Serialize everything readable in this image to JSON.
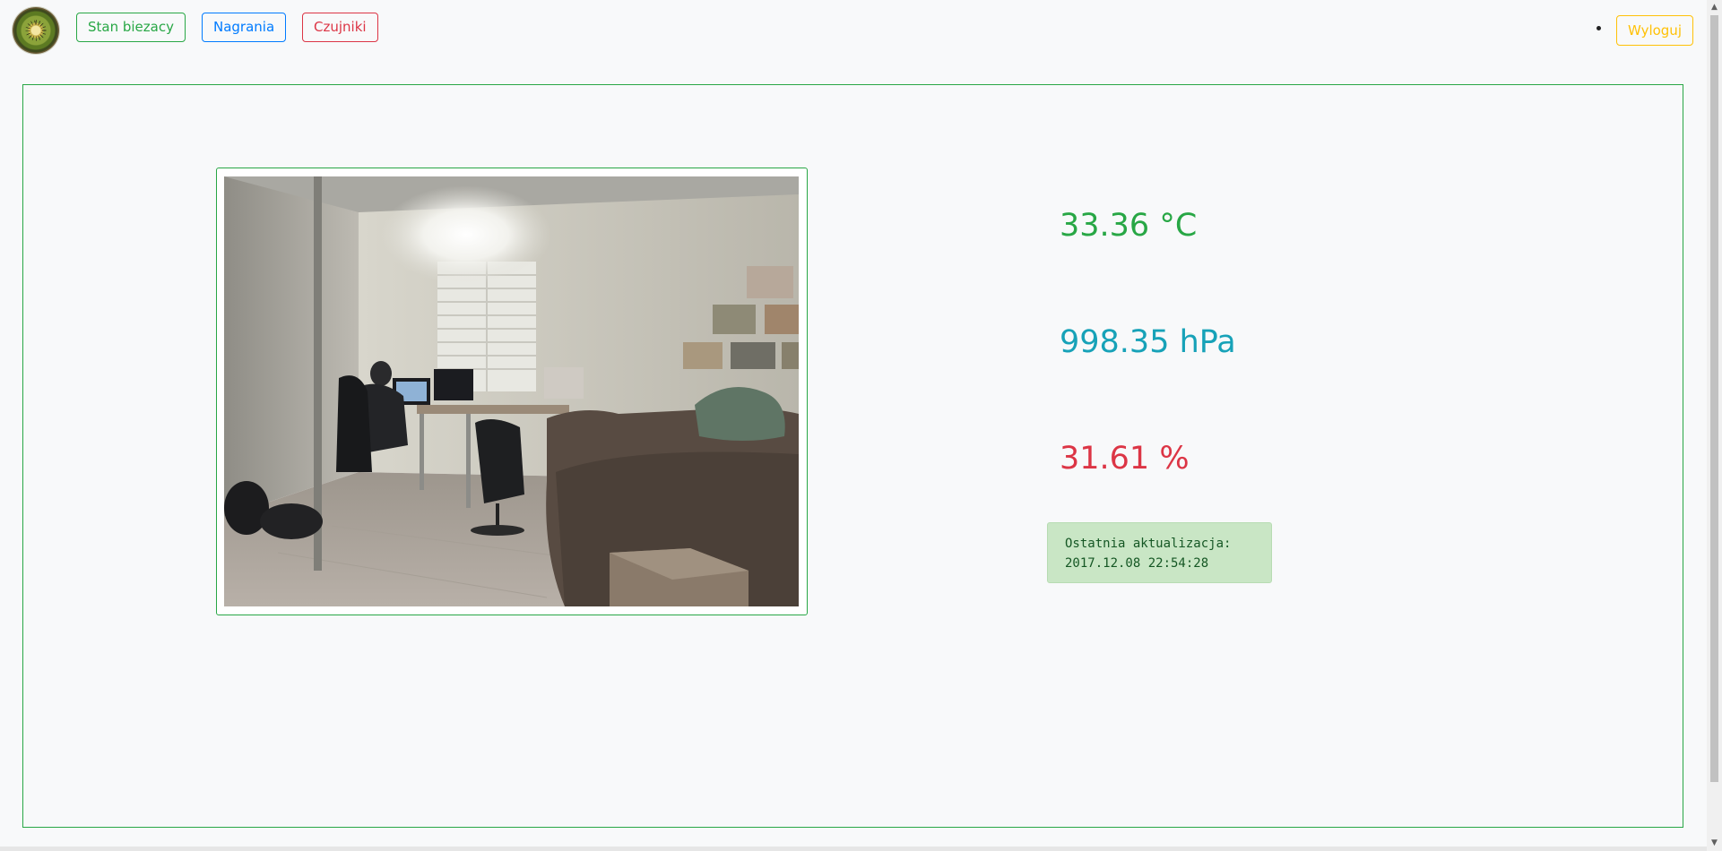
{
  "navbar": {
    "logo_icon": "kiwi-fruit-logo",
    "buttons": {
      "current": "Stan biezacy",
      "recordings": "Nagrania",
      "sensors": "Czujniki"
    },
    "logout": "Wyloguj"
  },
  "main": {
    "camera_image_icon": "room-camera-snapshot",
    "readings": {
      "temperature": "33.36 °C",
      "pressure": "998.35 hPa",
      "humidity": "31.61 %"
    },
    "last_update": {
      "label": "Ostatnia aktualizacja:",
      "value": "2017.12.08 22:54:28"
    }
  },
  "colors": {
    "green": "#28a745",
    "blue": "#007bff",
    "red": "#dc3545",
    "info": "#17a2b8",
    "yellow": "#ffc107"
  }
}
